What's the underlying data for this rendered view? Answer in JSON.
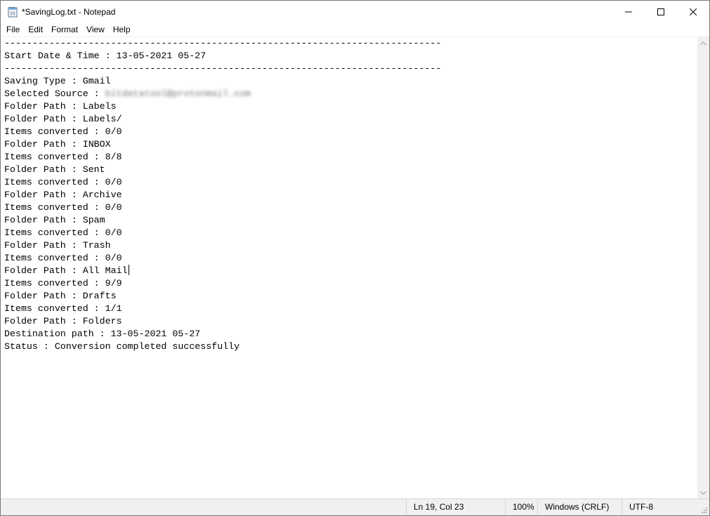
{
  "window": {
    "title": "*SavingLog.txt - Notepad",
    "controls": [
      "minimize-icon",
      "maximize-icon",
      "close-icon"
    ]
  },
  "menu": [
    "File",
    "Edit",
    "Format",
    "View",
    "Help"
  ],
  "editor": {
    "lines": [
      "------------------------------------------------------------------------------",
      "Start Date & Time : 13-05-2021 05-27",
      "------------------------------------------------------------------------------",
      "Saving Type : Gmail",
      "Selected Source : ",
      "Folder Path : Labels",
      "Folder Path : Labels/",
      "Items converted : 0/0",
      "Folder Path : INBOX",
      "Items converted : 8/8",
      "Folder Path : Sent",
      "Items converted : 0/0",
      "Folder Path : Archive",
      "Items converted : 0/0",
      "Folder Path : Spam",
      "Items converted : 0/0",
      "Folder Path : Trash",
      "Items converted : 0/0",
      "Folder Path : All Mail",
      "Items converted : 9/9",
      "Folder Path : Drafts",
      "Items converted : 1/1",
      "Folder Path : Folders",
      "Destination path : 13-05-2021 05-27",
      "Status : Conversion completed successfully"
    ],
    "redacted_source": "bitdatatool@protonmail.com",
    "caret_line": 19
  },
  "status": {
    "position": "Ln 19, Col 23",
    "zoom": "100%",
    "line_ending": "Windows (CRLF)",
    "encoding": "UTF-8"
  }
}
